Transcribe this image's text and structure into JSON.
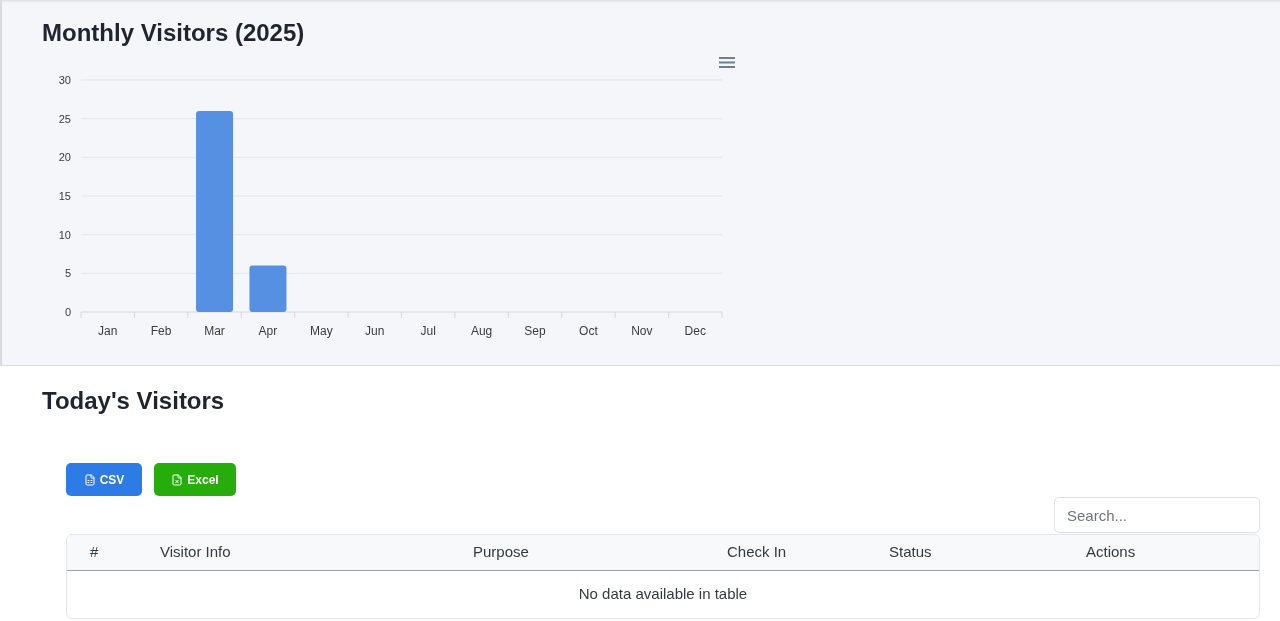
{
  "chart_section": {
    "title": "Monthly Visitors (2025)",
    "chart_data": {
      "type": "bar",
      "categories": [
        "Jan",
        "Feb",
        "Mar",
        "Apr",
        "May",
        "Jun",
        "Jul",
        "Aug",
        "Sep",
        "Oct",
        "Nov",
        "Dec"
      ],
      "values": [
        0,
        0,
        26,
        6,
        0,
        0,
        0,
        0,
        0,
        0,
        0,
        0
      ],
      "ylim": [
        0,
        30
      ],
      "yticks": [
        0,
        5,
        10,
        15,
        20,
        25,
        30
      ],
      "grid": true
    }
  },
  "visitors_section": {
    "title": "Today's Visitors",
    "export_buttons": [
      {
        "kind": "csv",
        "label": "CSV"
      },
      {
        "kind": "excel",
        "label": "Excel"
      }
    ],
    "search": {
      "placeholder": "Search..."
    },
    "table": {
      "columns": [
        "#",
        "Visitor Info",
        "Purpose",
        "Check In",
        "Status",
        "Actions"
      ],
      "empty_message": "No data available in table"
    }
  }
}
